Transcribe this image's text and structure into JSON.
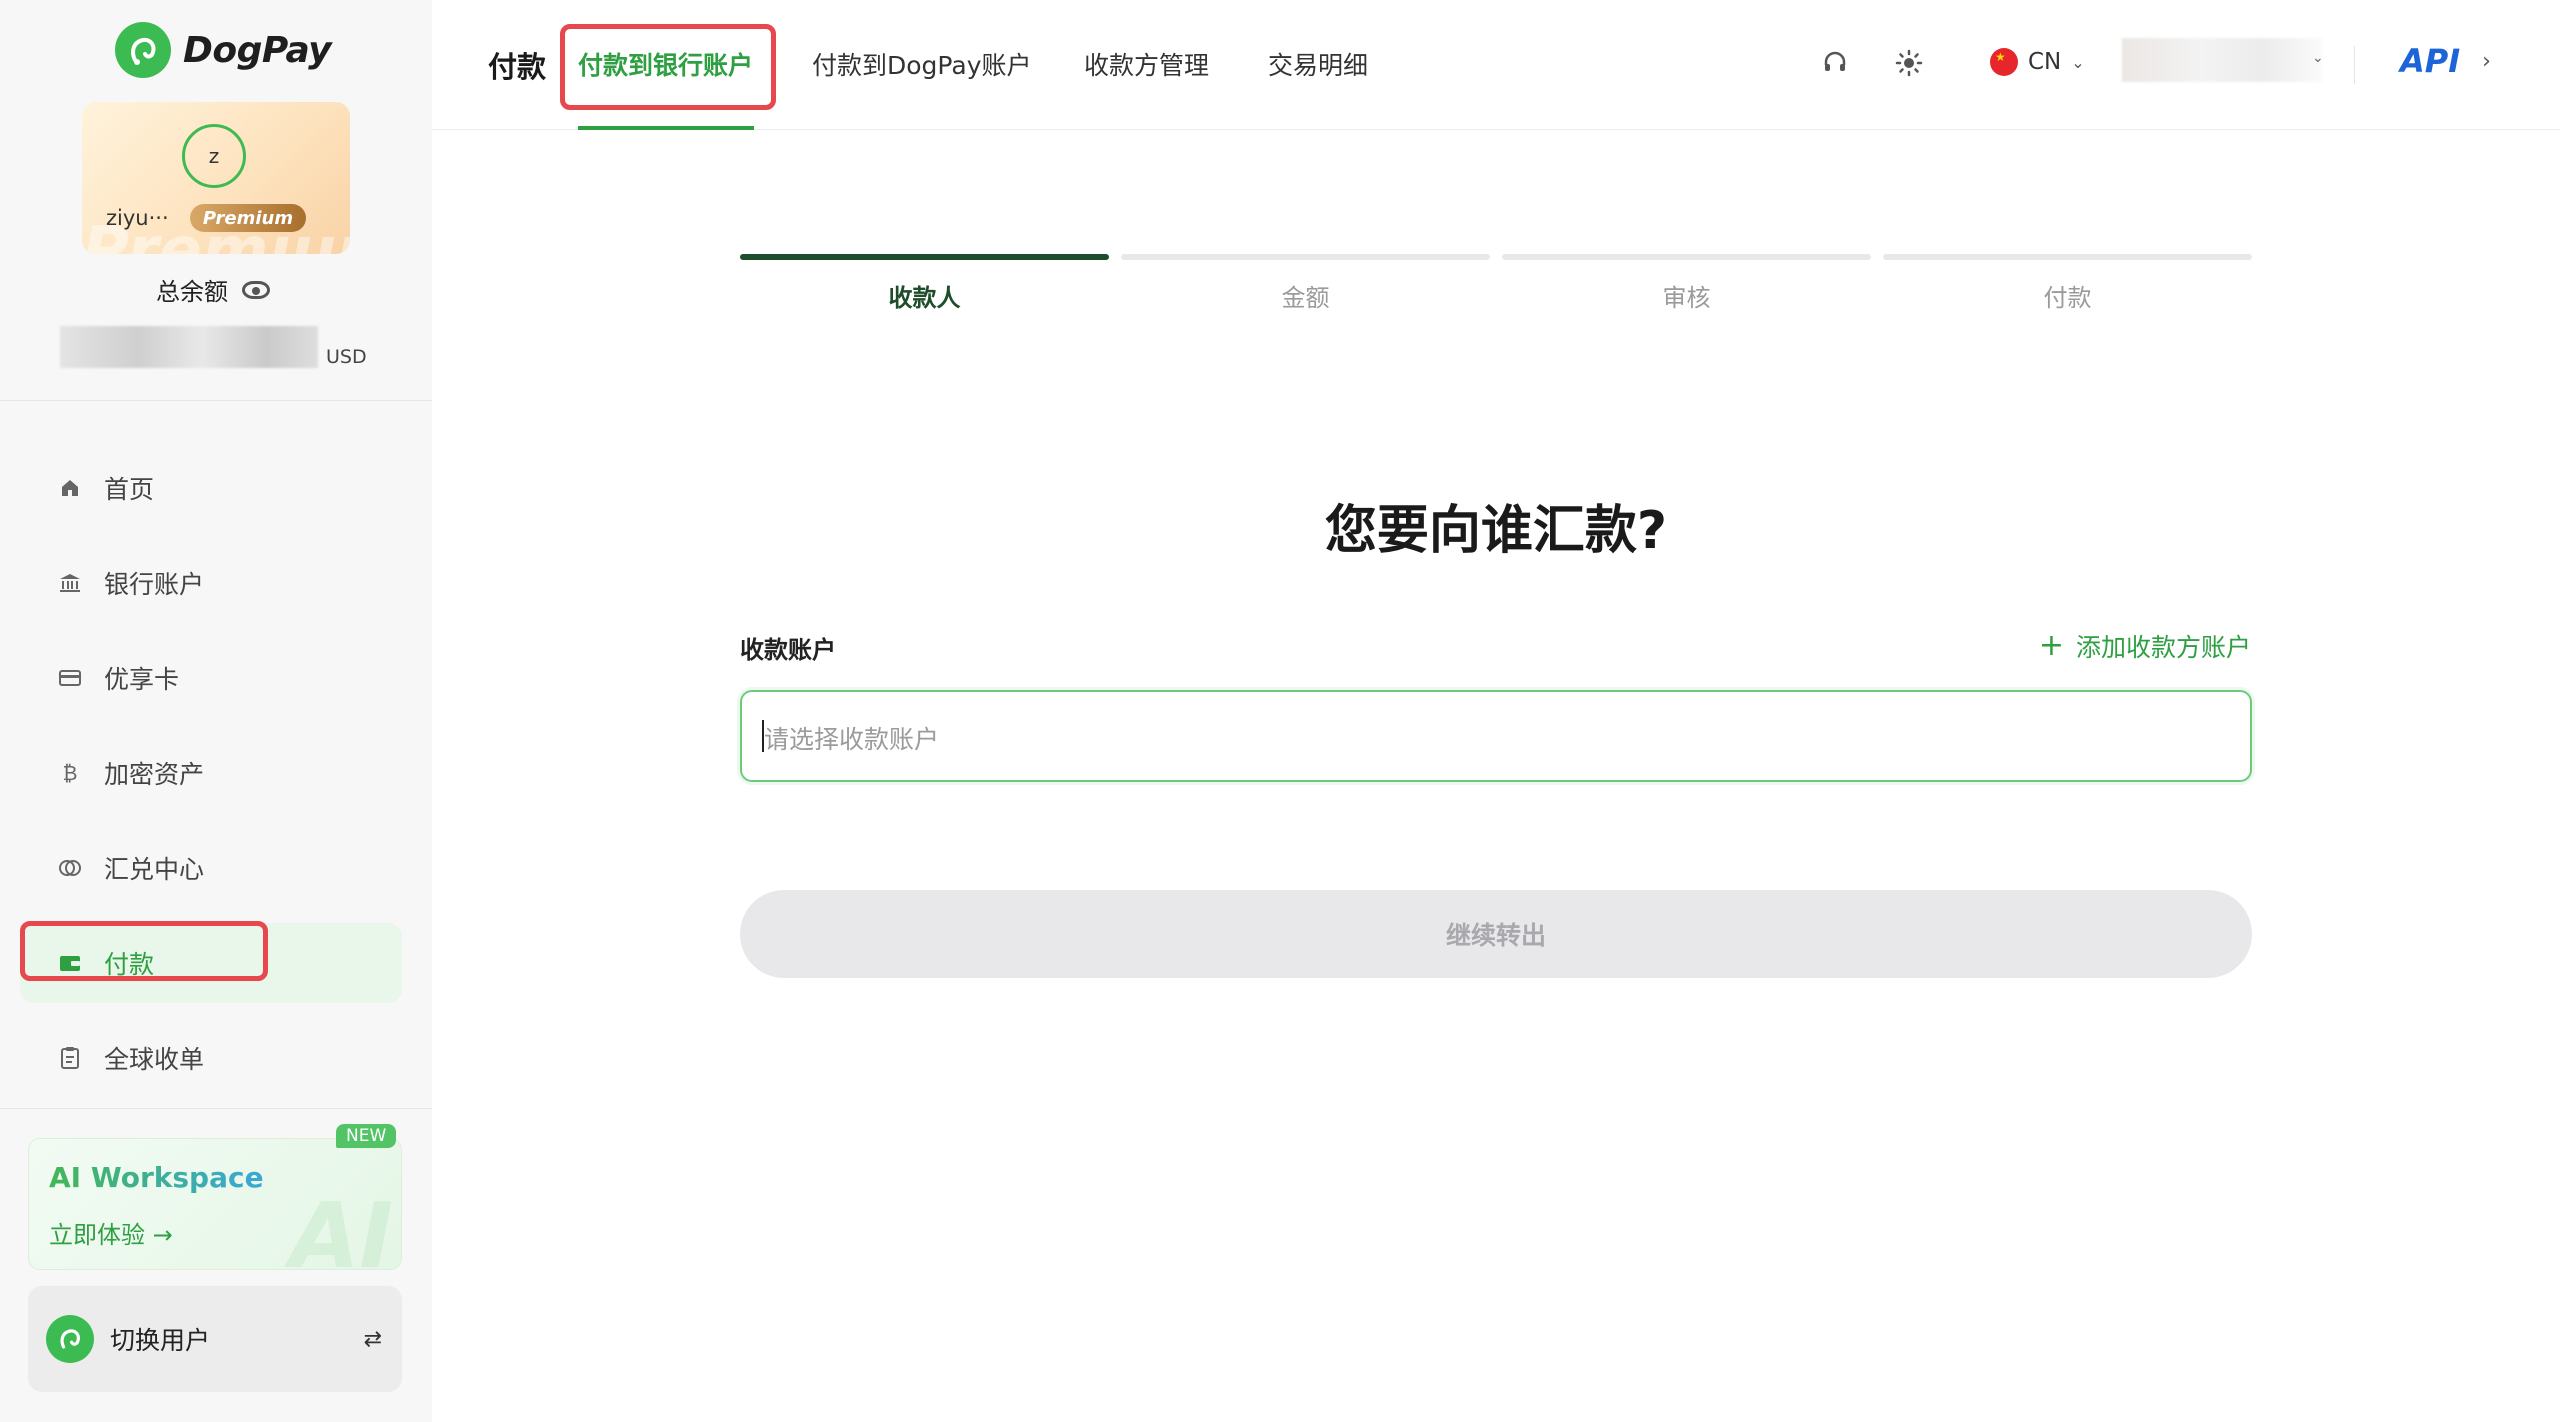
{
  "brand": {
    "name": "DogPay",
    "accent": "#2ea042"
  },
  "user_card": {
    "avatar_letter": "z",
    "username": "ziyu···",
    "badge": "Premium",
    "watermark": "Premium"
  },
  "balance": {
    "label": "总余额",
    "currency": "USD"
  },
  "sidebar": {
    "items": [
      {
        "label": "首页",
        "icon": "home-icon"
      },
      {
        "label": "银行账户",
        "icon": "bank-icon"
      },
      {
        "label": "优享卡",
        "icon": "card-icon"
      },
      {
        "label": "加密资产",
        "icon": "bitcoin-icon"
      },
      {
        "label": "汇兑中心",
        "icon": "exchange-icon"
      },
      {
        "label": "付款",
        "icon": "wallet-icon",
        "active": true
      },
      {
        "label": "全球收单",
        "icon": "clipboard-icon"
      }
    ],
    "ai_workspace": {
      "badge": "NEW",
      "title": "AI Workspace",
      "cta": "立即体验 →",
      "background_text": "AI"
    },
    "switch_user": {
      "label": "切换用户",
      "icon": "swap-icon"
    }
  },
  "header": {
    "title": "付款",
    "tabs": [
      {
        "label": "付款到银行账户",
        "active": true
      },
      {
        "label": "付款到DogPay账户"
      },
      {
        "label": "收款方管理"
      },
      {
        "label": "交易明细"
      }
    ],
    "language": "CN",
    "api_label": "API"
  },
  "steps": [
    {
      "label": "收款人",
      "active": true
    },
    {
      "label": "金额"
    },
    {
      "label": "审核"
    },
    {
      "label": "付款"
    }
  ],
  "main": {
    "heading": "您要向谁汇款?",
    "field_label": "收款账户",
    "add_link": "添加收款方账户",
    "placeholder": "请选择收款账户",
    "continue_label": "继续转出"
  }
}
